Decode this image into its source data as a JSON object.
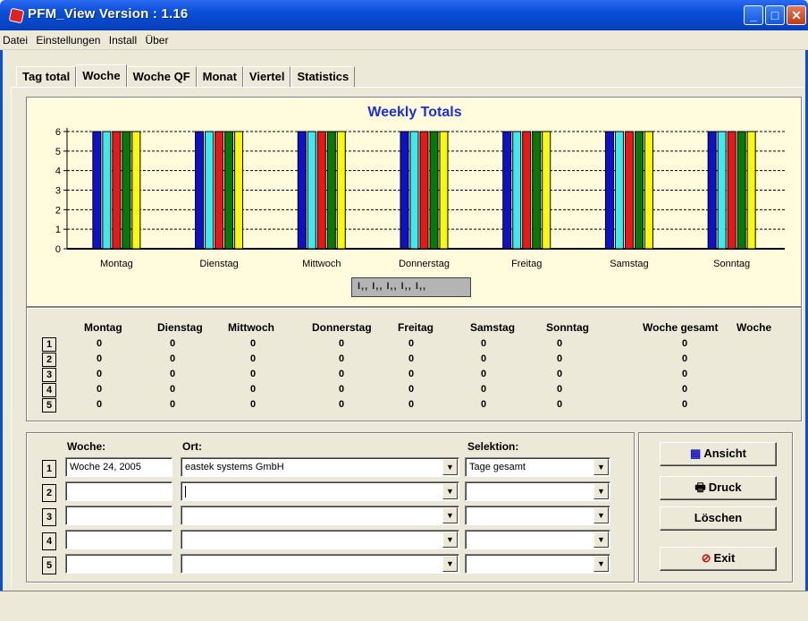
{
  "window": {
    "title": "PFM_View Version :  1.16"
  },
  "menu": [
    "Datei",
    "Einstellungen",
    "Install",
    "Über"
  ],
  "tabs": [
    {
      "label": "Tag total",
      "active": false
    },
    {
      "label": "Woche",
      "active": true
    },
    {
      "label": "Woche QF",
      "active": false
    },
    {
      "label": "Monat",
      "active": false
    },
    {
      "label": "Viertel",
      "active": false
    },
    {
      "label": "Statistics",
      "active": false
    }
  ],
  "chart_data": {
    "type": "bar",
    "title": "Weekly Totals",
    "categories": [
      "Montag",
      "Dienstag",
      "Mittwoch",
      "Donnerstag",
      "Freitag",
      "Samstag",
      "Sonntag"
    ],
    "series": [
      {
        "color": "#1010c8",
        "values": [
          6,
          6,
          6,
          6,
          6,
          6,
          6
        ]
      },
      {
        "color": "#40e8f0",
        "values": [
          6,
          6,
          6,
          6,
          6,
          6,
          6
        ]
      },
      {
        "color": "#e81818",
        "values": [
          6,
          6,
          6,
          6,
          6,
          6,
          6
        ]
      },
      {
        "color": "#087808",
        "values": [
          6,
          6,
          6,
          6,
          6,
          6,
          6
        ]
      },
      {
        "color": "#f8f810",
        "values": [
          6,
          6,
          6,
          6,
          6,
          6,
          6
        ]
      }
    ],
    "y_ticks": [
      "0",
      "1",
      "2",
      "3",
      "4",
      "5",
      "6"
    ],
    "ylim": [
      0,
      6
    ],
    "grid": true,
    "scroll_widget_label": "I,, I,, I,, I,, I,,"
  },
  "summary_table": {
    "columns": [
      "Montag",
      "Dienstag",
      "Mittwoch",
      "Donnerstag",
      "Freitag",
      "Samstag",
      "Sonntag",
      "Woche gesamt",
      "Woche"
    ],
    "rows": [
      {
        "num": "1",
        "values": [
          "0",
          "0",
          "0",
          "0",
          "0",
          "0",
          "0",
          "0"
        ]
      },
      {
        "num": "2",
        "values": [
          "0",
          "0",
          "0",
          "0",
          "0",
          "0",
          "0",
          "0"
        ]
      },
      {
        "num": "3",
        "values": [
          "0",
          "0",
          "0",
          "0",
          "0",
          "0",
          "0",
          "0"
        ]
      },
      {
        "num": "4",
        "values": [
          "0",
          "0",
          "0",
          "0",
          "0",
          "0",
          "0",
          "0"
        ]
      },
      {
        "num": "5",
        "values": [
          "0",
          "0",
          "0",
          "0",
          "0",
          "0",
          "0",
          "0"
        ]
      }
    ]
  },
  "selection": {
    "labels": {
      "woche": "Woche:",
      "ort": "Ort:",
      "selektion": "Selektion:"
    },
    "rows": [
      {
        "num": "1",
        "woche": "Woche 24, 2005",
        "ort": "eastek systems GmbH",
        "selektion": "Tage gesamt"
      },
      {
        "num": "2",
        "woche": "",
        "ort": "",
        "selektion": ""
      },
      {
        "num": "3",
        "woche": "",
        "ort": "",
        "selektion": ""
      },
      {
        "num": "4",
        "woche": "",
        "ort": "",
        "selektion": ""
      },
      {
        "num": "5",
        "woche": "",
        "ort": "",
        "selektion": ""
      }
    ]
  },
  "buttons": {
    "ansicht": "Ansicht",
    "druck": "Druck",
    "loeschen": "Löschen",
    "exit": "Exit"
  }
}
